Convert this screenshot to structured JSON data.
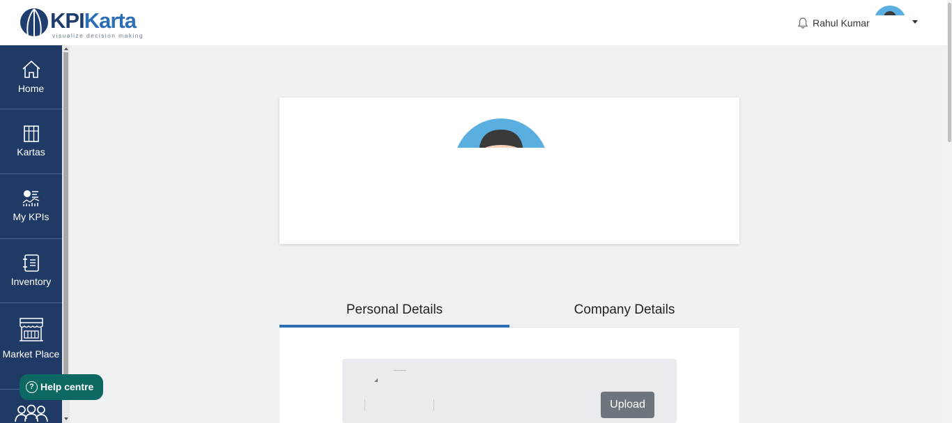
{
  "header": {
    "logo_text": "KPIKarta",
    "tagline": "visualize decision making",
    "user_name": "Rahul Kumar"
  },
  "sidebar": {
    "items": [
      {
        "label": "Home",
        "icon": "home-icon"
      },
      {
        "label": "Kartas",
        "icon": "kartas-icon"
      },
      {
        "label": "My KPIs",
        "icon": "kpis-icon"
      },
      {
        "label": "Inventory",
        "icon": "inventory-icon"
      },
      {
        "label": "Market Place",
        "icon": "market-place-icon"
      },
      {
        "label": "",
        "icon": "team-icon"
      }
    ],
    "help": "Help centre"
  },
  "profile": {
    "tabs": [
      {
        "label": "Personal Details",
        "active": true
      },
      {
        "label": "Company Details",
        "active": false
      }
    ],
    "upload_label": "Upload"
  },
  "colors": {
    "sidebar_bg": "#203a66",
    "brand_blue": "#2d6fb5",
    "help_bg": "#0c6863",
    "avatar_blue": "#5aafe0"
  }
}
